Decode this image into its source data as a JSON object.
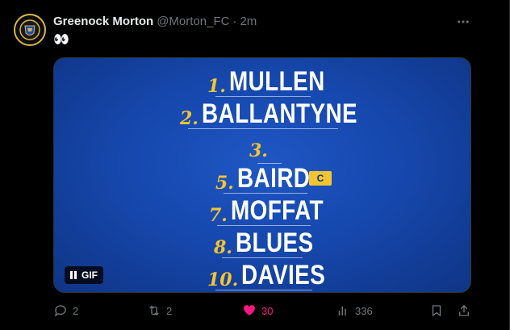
{
  "tweet": {
    "author_name": "Greenock Morton",
    "handle": "@Morton_FC",
    "separator": "·",
    "time": "2m",
    "text": "👀"
  },
  "media": {
    "lineup": [
      {
        "number": "1.",
        "name": "MULLEN"
      },
      {
        "number": "2.",
        "name": "BALLANTYNE"
      },
      {
        "number": "3.",
        "name": ""
      },
      {
        "number": "5.",
        "name": "BAIRD"
      },
      {
        "number": "7.",
        "name": "MOFFAT"
      },
      {
        "number": "8.",
        "name": "BLUES"
      },
      {
        "number": "10.",
        "name": "DAVIES"
      }
    ],
    "captain_badge": "C",
    "gif_label": "GIF",
    "colors": {
      "background": "#1648ae",
      "accent": "#f3c431",
      "text": "#ffffff"
    }
  },
  "actions": {
    "replies": "2",
    "reposts": "2",
    "likes": "30",
    "views": "336",
    "like_color": "#f91880"
  },
  "icons": [
    "more-icon",
    "reply-icon",
    "repost-icon",
    "like-icon",
    "views-icon",
    "bookmark-icon",
    "share-icon",
    "pause-icon"
  ]
}
